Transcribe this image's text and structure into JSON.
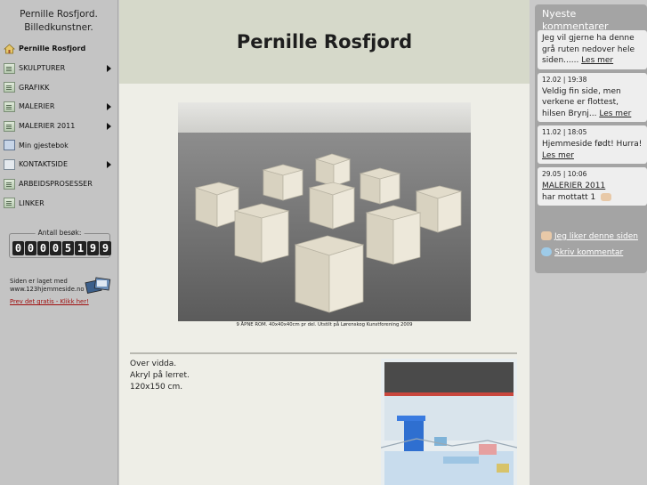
{
  "site": {
    "title_line1": "Pernille Rosfjord.",
    "title_line2": "Billedkunstner."
  },
  "nav": [
    {
      "label": "Pernille Rosfjord",
      "icon": "home-icon",
      "arrow": false,
      "active": true
    },
    {
      "label": "SKULPTURER",
      "icon": "page-icon",
      "arrow": true,
      "active": false
    },
    {
      "label": "GRAFIKK",
      "icon": "page-icon",
      "arrow": false,
      "active": false
    },
    {
      "label": "MALERIER",
      "icon": "page-icon",
      "arrow": true,
      "active": false
    },
    {
      "label": "MALERIER 2011",
      "icon": "page-icon",
      "arrow": true,
      "active": false
    },
    {
      "label": "Min gjestebok",
      "icon": "guestbook-icon",
      "arrow": false,
      "active": false
    },
    {
      "label": "KONTAKTSIDE",
      "icon": "contact-icon",
      "arrow": true,
      "active": false
    },
    {
      "label": "ARBEIDSPROSESSER",
      "icon": "page-icon",
      "arrow": false,
      "active": false
    },
    {
      "label": "LINKER",
      "icon": "page-icon",
      "arrow": false,
      "active": false
    }
  ],
  "counter": {
    "label": "Antall besøk:",
    "digits": [
      "0",
      "0",
      "0",
      "0",
      "5",
      "1",
      "9",
      "9"
    ]
  },
  "footer": {
    "made_with_line1": "Siden er laget med",
    "made_with_line2": "www.123hjemmeside.no",
    "free_link": "Prev det gratis - Klikk her!"
  },
  "main": {
    "title": "Pernille Rosfjord",
    "photo_caption": "9 ÅPNE ROM. 40x40x40cm pr del. Utstilt på Lørenskog Kunstforening 2009",
    "desc_lines": [
      "Over vidda.",
      "Akryl på lerret.",
      "120x150 cm."
    ]
  },
  "comments": {
    "title_line1": "Nyeste",
    "title_line2": "kommentarer",
    "items": [
      {
        "date": "",
        "text": "Jeg vil gjerne ha denne grå ruten nedover hele siden......",
        "more": "Les mer",
        "overlap": "kom...ntarer"
      },
      {
        "date": "12.02 | 19:38",
        "text": "Veldig fin side, men verkene er flottest, hilsen Brynj...",
        "more": "Les mer"
      },
      {
        "date": "11.02 | 18:05",
        "text": "Hjemmeside født! Hurra!",
        "more": "Les mer"
      },
      {
        "date": "29.05 | 10:06",
        "link": "MALERIER 2011",
        "text": "har mottatt 1"
      }
    ],
    "like": "Jeg liker denne siden",
    "write": "Skriv kommentar"
  },
  "colors": {
    "header_bg": "#d6d9ca",
    "content_bg": "#eeeee7",
    "sidebar_bg": "#c4c4c4",
    "comments_bg": "#a4a4a4",
    "link_red": "#a01010"
  }
}
